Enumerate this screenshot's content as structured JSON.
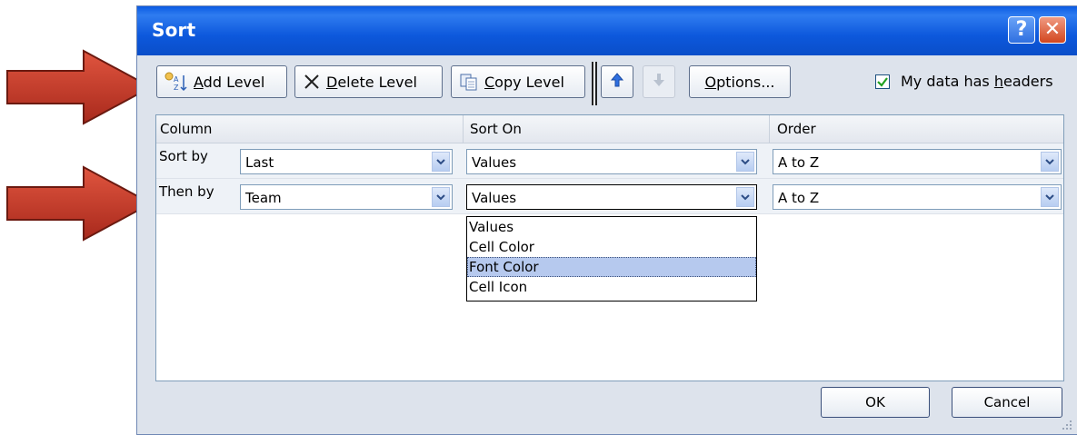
{
  "dialog": {
    "title": "Sort",
    "help_label": "?",
    "close_label": "✕"
  },
  "toolbar": {
    "add_level": {
      "pre": "",
      "u": "A",
      "post": "dd Level"
    },
    "delete_level": {
      "pre": "",
      "u": "D",
      "post": "elete Level"
    },
    "copy_level": {
      "pre": "",
      "u": "C",
      "post": "opy Level"
    },
    "options": {
      "pre": "",
      "u": "O",
      "post": "ptions..."
    },
    "headers_checkbox": {
      "pre": "My data has ",
      "u": "h",
      "post": "eaders",
      "checked": true
    }
  },
  "columns": {
    "column": "Column",
    "sort_on": "Sort On",
    "order": "Order"
  },
  "rows": [
    {
      "label": "Sort by",
      "column": "Last",
      "sort_on": "Values",
      "order": "A to Z"
    },
    {
      "label": "Then by",
      "column": "Team",
      "sort_on": "Values",
      "order": "A to Z"
    }
  ],
  "sort_on_options": [
    "Values",
    "Cell Color",
    "Font Color",
    "Cell Icon"
  ],
  "selected_option": "Font Color",
  "buttons": {
    "ok": "OK",
    "cancel": "Cancel"
  },
  "colors": {
    "title_bar": "#0a5be3",
    "arrow": "#c0392b",
    "selection": "#b6c9ee"
  }
}
